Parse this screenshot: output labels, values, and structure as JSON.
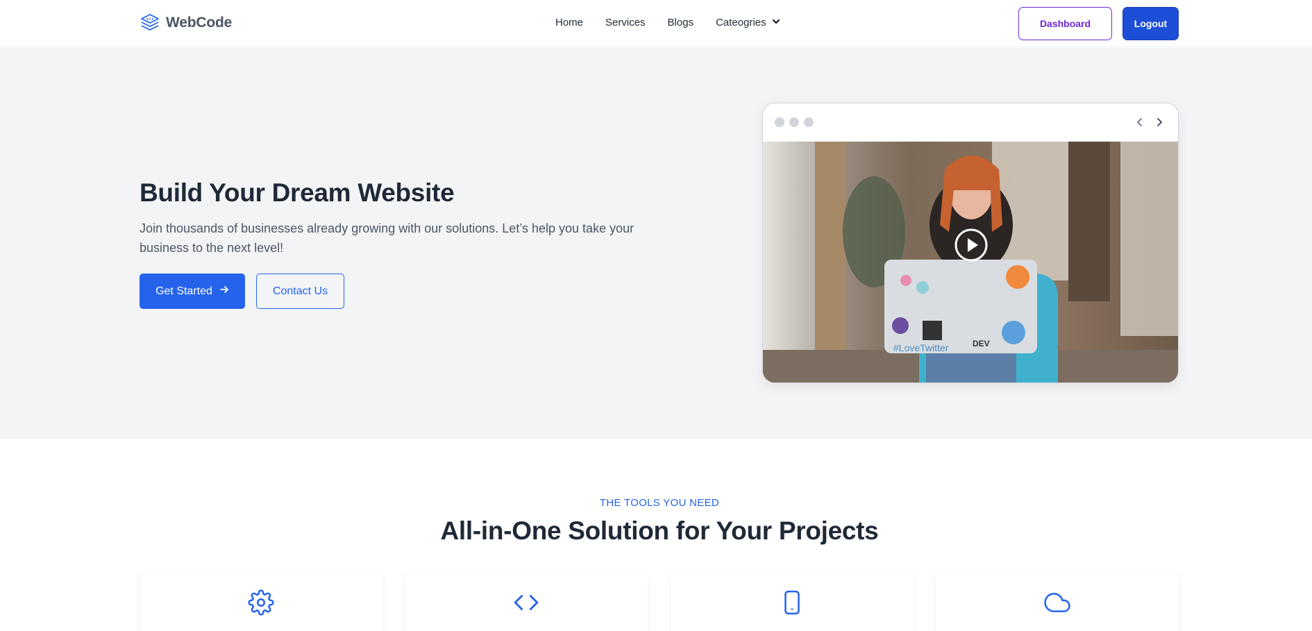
{
  "header": {
    "brand": "WebCode",
    "nav": [
      {
        "label": "Home"
      },
      {
        "label": "Services"
      },
      {
        "label": "Blogs"
      },
      {
        "label": "Cateogries"
      }
    ],
    "dashboard_label": "Dashboard",
    "logout_label": "Logout"
  },
  "hero": {
    "title": "Build Your Dream Website",
    "subtitle": "Join thousands of businesses already growing with our solutions. Let’s help you take your business to the next level!",
    "primary_button": "Get Started",
    "secondary_button": "Contact Us"
  },
  "tools": {
    "eyebrow": "THE TOOLS YOU NEED",
    "title": "All-in-One Solution for Your Projects",
    "cards": [
      {
        "icon": "gear-icon"
      },
      {
        "icon": "code-icon"
      },
      {
        "icon": "mobile-icon"
      },
      {
        "icon": "cloud-icon"
      }
    ]
  },
  "colors": {
    "accent": "#2563eb",
    "dashboard_border": "#6d28d9",
    "hero_bg": "#f3f4f6"
  }
}
